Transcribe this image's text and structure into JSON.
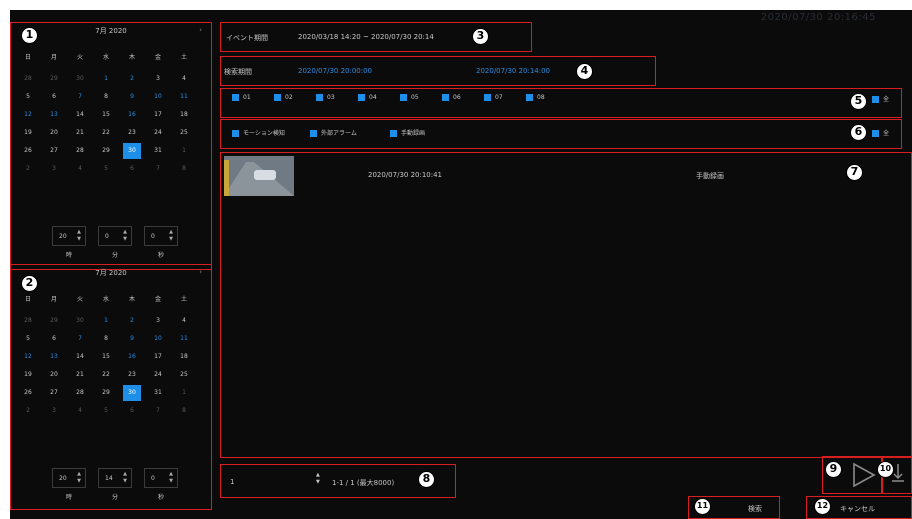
{
  "header": {
    "clock": "2020/07/30 20:16:45"
  },
  "calendars": [
    {
      "month_label": "7月 2020",
      "weekdays": [
        "日",
        "月",
        "火",
        "水",
        "木",
        "金",
        "土"
      ],
      "days": [
        [
          {
            "d": "28",
            "c": "out"
          },
          {
            "d": "29",
            "c": "out"
          },
          {
            "d": "30",
            "c": "out"
          },
          {
            "d": "1",
            "c": "blue"
          },
          {
            "d": "2",
            "c": "blue"
          },
          {
            "d": "3",
            "c": "norm"
          },
          {
            "d": "4",
            "c": "norm"
          }
        ],
        [
          {
            "d": "5",
            "c": "norm"
          },
          {
            "d": "6",
            "c": "norm"
          },
          {
            "d": "7",
            "c": "blue"
          },
          {
            "d": "8",
            "c": "norm"
          },
          {
            "d": "9",
            "c": "blue"
          },
          {
            "d": "10",
            "c": "blue"
          },
          {
            "d": "11",
            "c": "blue"
          }
        ],
        [
          {
            "d": "12",
            "c": "blue"
          },
          {
            "d": "13",
            "c": "blue"
          },
          {
            "d": "14",
            "c": "norm"
          },
          {
            "d": "15",
            "c": "norm"
          },
          {
            "d": "16",
            "c": "blue"
          },
          {
            "d": "17",
            "c": "norm"
          },
          {
            "d": "18",
            "c": "norm"
          }
        ],
        [
          {
            "d": "19",
            "c": "norm"
          },
          {
            "d": "20",
            "c": "norm"
          },
          {
            "d": "21",
            "c": "norm"
          },
          {
            "d": "22",
            "c": "norm"
          },
          {
            "d": "23",
            "c": "norm"
          },
          {
            "d": "24",
            "c": "norm"
          },
          {
            "d": "25",
            "c": "norm"
          }
        ],
        [
          {
            "d": "26",
            "c": "norm"
          },
          {
            "d": "27",
            "c": "norm"
          },
          {
            "d": "28",
            "c": "norm"
          },
          {
            "d": "29",
            "c": "norm"
          },
          {
            "d": "30",
            "c": "sel"
          },
          {
            "d": "31",
            "c": "norm"
          },
          {
            "d": "1",
            "c": "out"
          }
        ],
        [
          {
            "d": "2",
            "c": "out"
          },
          {
            "d": "3",
            "c": "out"
          },
          {
            "d": "4",
            "c": "out"
          },
          {
            "d": "5",
            "c": "out"
          },
          {
            "d": "6",
            "c": "out"
          },
          {
            "d": "7",
            "c": "out"
          },
          {
            "d": "8",
            "c": "out"
          }
        ]
      ],
      "time": {
        "hour": "20",
        "minute": "0",
        "second": "0"
      },
      "units": {
        "hour": "時",
        "minute": "分",
        "second": "秒"
      }
    },
    {
      "month_label": "7月 2020",
      "weekdays": [
        "日",
        "月",
        "火",
        "水",
        "木",
        "金",
        "土"
      ],
      "days": [
        [
          {
            "d": "28",
            "c": "out"
          },
          {
            "d": "29",
            "c": "out"
          },
          {
            "d": "30",
            "c": "out"
          },
          {
            "d": "1",
            "c": "blue"
          },
          {
            "d": "2",
            "c": "blue"
          },
          {
            "d": "3",
            "c": "norm"
          },
          {
            "d": "4",
            "c": "norm"
          }
        ],
        [
          {
            "d": "5",
            "c": "norm"
          },
          {
            "d": "6",
            "c": "norm"
          },
          {
            "d": "7",
            "c": "blue"
          },
          {
            "d": "8",
            "c": "norm"
          },
          {
            "d": "9",
            "c": "blue"
          },
          {
            "d": "10",
            "c": "blue"
          },
          {
            "d": "11",
            "c": "blue"
          }
        ],
        [
          {
            "d": "12",
            "c": "blue"
          },
          {
            "d": "13",
            "c": "blue"
          },
          {
            "d": "14",
            "c": "norm"
          },
          {
            "d": "15",
            "c": "norm"
          },
          {
            "d": "16",
            "c": "blue"
          },
          {
            "d": "17",
            "c": "norm"
          },
          {
            "d": "18",
            "c": "norm"
          }
        ],
        [
          {
            "d": "19",
            "c": "norm"
          },
          {
            "d": "20",
            "c": "norm"
          },
          {
            "d": "21",
            "c": "norm"
          },
          {
            "d": "22",
            "c": "norm"
          },
          {
            "d": "23",
            "c": "norm"
          },
          {
            "d": "24",
            "c": "norm"
          },
          {
            "d": "25",
            "c": "norm"
          }
        ],
        [
          {
            "d": "26",
            "c": "norm"
          },
          {
            "d": "27",
            "c": "norm"
          },
          {
            "d": "28",
            "c": "norm"
          },
          {
            "d": "29",
            "c": "norm"
          },
          {
            "d": "30",
            "c": "sel"
          },
          {
            "d": "31",
            "c": "norm"
          },
          {
            "d": "1",
            "c": "out"
          }
        ],
        [
          {
            "d": "2",
            "c": "out"
          },
          {
            "d": "3",
            "c": "out"
          },
          {
            "d": "4",
            "c": "out"
          },
          {
            "d": "5",
            "c": "out"
          },
          {
            "d": "6",
            "c": "out"
          },
          {
            "d": "7",
            "c": "out"
          },
          {
            "d": "8",
            "c": "out"
          }
        ]
      ],
      "time": {
        "hour": "20",
        "minute": "14",
        "second": "0"
      },
      "units": {
        "hour": "時",
        "minute": "分",
        "second": "秒"
      }
    }
  ],
  "callouts": [
    "1",
    "2",
    "3",
    "4",
    "5",
    "6",
    "7",
    "8",
    "9",
    "10",
    "11",
    "12"
  ],
  "event_period": {
    "label": "イベント期間",
    "value": "2020/03/18 14:20 ~ 2020/07/30 20:14"
  },
  "search_period": {
    "label": "検索期間",
    "start": "2020/07/30 20:00:00",
    "end": "2020/07/30 20:14:00"
  },
  "channels": [
    "01",
    "02",
    "03",
    "04",
    "05",
    "06",
    "07",
    "08"
  ],
  "channel_all_label": "全",
  "event_types": [
    "モーション検知",
    "外部アラーム",
    "手動録画"
  ],
  "event_all_label": "全",
  "results": [
    {
      "timestamp": "2020/07/30 20:10:41",
      "type": "手動録画"
    }
  ],
  "pagination": {
    "page_select": "1",
    "info": "1-1 / 1 (最大8000)"
  },
  "buttons": {
    "search": "検索",
    "cancel": "キャンセル"
  },
  "colors": {
    "accent": "#1e8fe8",
    "callout_border": "#d81e1e",
    "background": "#0b0b0c"
  }
}
